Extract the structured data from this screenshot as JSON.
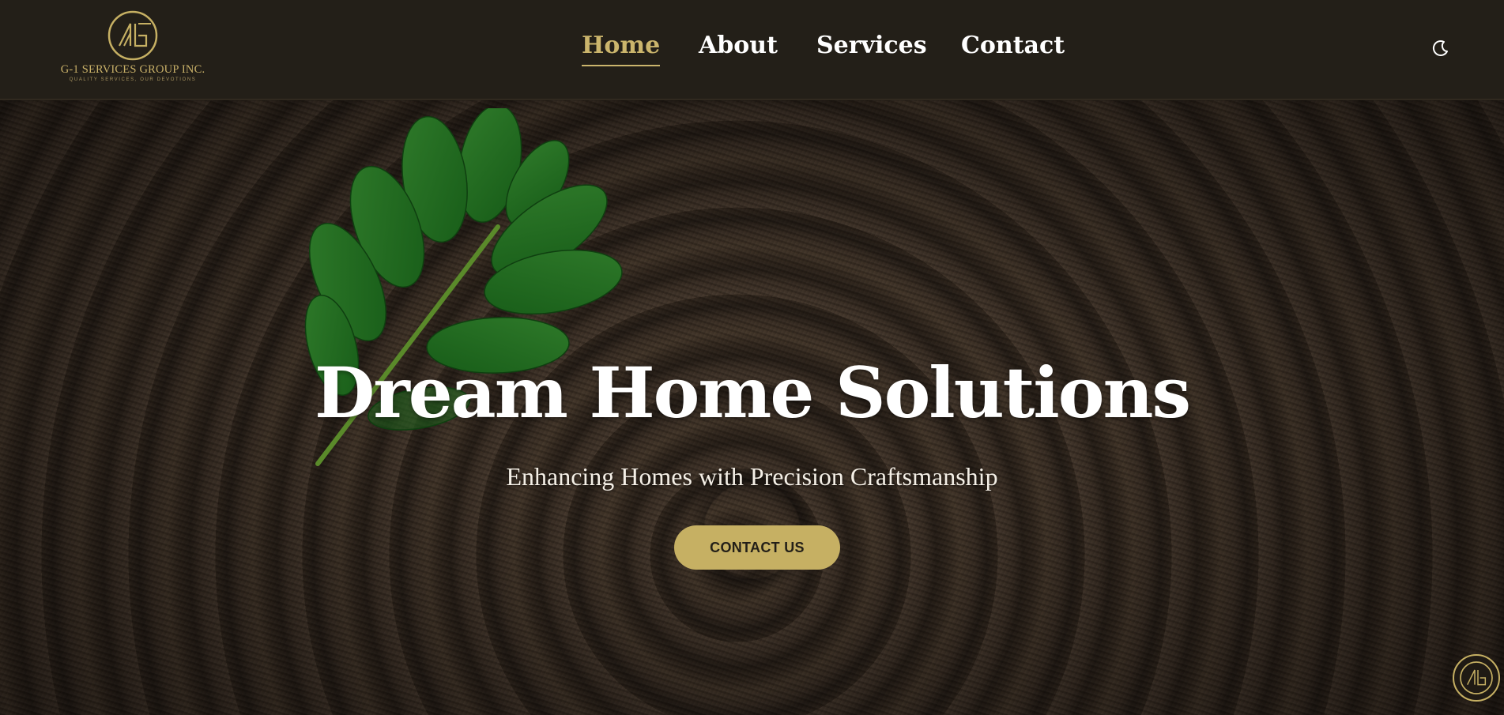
{
  "brand": {
    "name": "G-1 SERVICES GROUP INC.",
    "tagline": "QUALITY SERVICES, OUR DEVOTIONS",
    "logo_icon": "g1-monogram-icon",
    "accent_color": "#c6b063"
  },
  "nav": {
    "items": [
      {
        "label": "Home",
        "active": true
      },
      {
        "label": "About",
        "active": false
      },
      {
        "label": "Services",
        "active": false
      },
      {
        "label": "Contact",
        "active": false
      }
    ],
    "theme_toggle_icon": "moon-icon"
  },
  "hero": {
    "title": "Dream Home Solutions",
    "subtitle": "Enhancing Homes with Precision Craftsmanship",
    "cta_label": "CONTACT US",
    "background": "tree-rings-with-green-leaf"
  },
  "floating_badge": {
    "icon": "g1-monogram-icon"
  }
}
